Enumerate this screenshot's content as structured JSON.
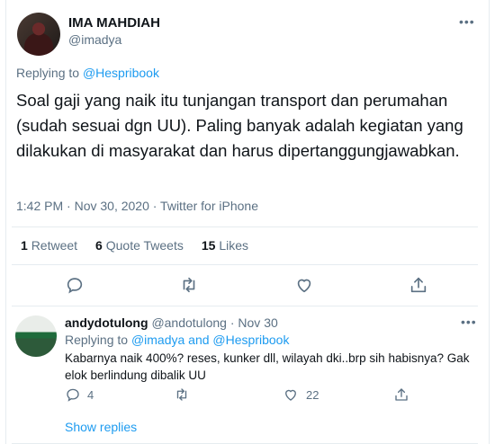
{
  "main_tweet": {
    "display_name": "IMA MAHDIAH",
    "handle": "@imadya",
    "more": "•••",
    "replying_prefix": "Replying to",
    "replying_handle": "@Hespribook",
    "text": "Soal gaji yang naik itu tunjangan transport dan perumahan (sudah sesuai dgn UU). Paling banyak adalah kegiatan yang dilakukan di masyarakat dan harus dipertanggungjawabkan.",
    "meta": "1:42 PM · Nov 30, 2020 · Twitter for iPhone",
    "stats": {
      "retweets_count": "1",
      "retweets_label": "Retweet",
      "quotes_count": "6",
      "quotes_label": "Quote Tweets",
      "likes_count": "15",
      "likes_label": "Likes"
    },
    "icons": [
      "reply-icon",
      "retweet-icon",
      "like-icon",
      "share-icon"
    ]
  },
  "reply": {
    "display_name": "andydotulong",
    "handle": "@andotulong",
    "separator": "·",
    "date": "Nov 30",
    "more": "•••",
    "replying_prefix": "Replying to",
    "replying_handle_1": "@imadya",
    "replying_and": "and",
    "replying_handle_2": "@Hespribook",
    "text": "Kabarnya naik 400%? reses, kunker dll, wilayah dki..brp sih habisnya? Gak elok berlindung dibalik UU",
    "reply_count": "4",
    "like_count": "22"
  },
  "show_replies": "Show replies",
  "colors": {
    "link": "#1d9bf0",
    "secondary_text": "#5b7083",
    "primary_text": "#0f1419",
    "divider": "#e6ecf0"
  }
}
